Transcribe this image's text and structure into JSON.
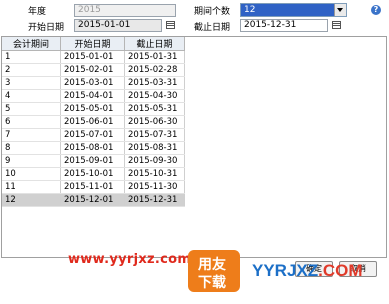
{
  "header": {
    "year_label": "年度",
    "year_value": "2015",
    "start_label": "开始日期",
    "start_value": "2015-01-01",
    "periods_label": "期间个数",
    "periods_value": "12",
    "end_label": "截止日期",
    "end_value": "2015-12-31",
    "help_glyph": "?"
  },
  "table": {
    "columns": [
      "会计期间",
      "开始日期",
      "截止日期"
    ],
    "rows": [
      [
        "1",
        "2015-01-01",
        "2015-01-31"
      ],
      [
        "2",
        "2015-02-01",
        "2015-02-28"
      ],
      [
        "3",
        "2015-03-01",
        "2015-03-31"
      ],
      [
        "4",
        "2015-04-01",
        "2015-04-30"
      ],
      [
        "5",
        "2015-05-01",
        "2015-05-31"
      ],
      [
        "6",
        "2015-06-01",
        "2015-06-30"
      ],
      [
        "7",
        "2015-07-01",
        "2015-07-31"
      ],
      [
        "8",
        "2015-08-01",
        "2015-08-31"
      ],
      [
        "9",
        "2015-09-01",
        "2015-09-30"
      ],
      [
        "10",
        "2015-10-01",
        "2015-10-31"
      ],
      [
        "11",
        "2015-11-01",
        "2015-11-30"
      ],
      [
        "12",
        "2015-12-01",
        "2015-12-31"
      ]
    ],
    "selected_row_index": 11
  },
  "buttons": {
    "ok_label": "确定",
    "cancel_label": "取消"
  },
  "watermark": {
    "url": "www.yyrjxz.com",
    "logo_top": "用友",
    "logo_bottom": "下载",
    "brand_a": "YYRJXZ",
    "brand_b": ".COM"
  },
  "colors": {
    "select_highlight": "#2f62c5",
    "selected_row": "#d0d0d0",
    "watermark_red": "#e0291c",
    "watermark_orange": "#ee7d1a",
    "watermark_blue": "#1c6fc7"
  }
}
